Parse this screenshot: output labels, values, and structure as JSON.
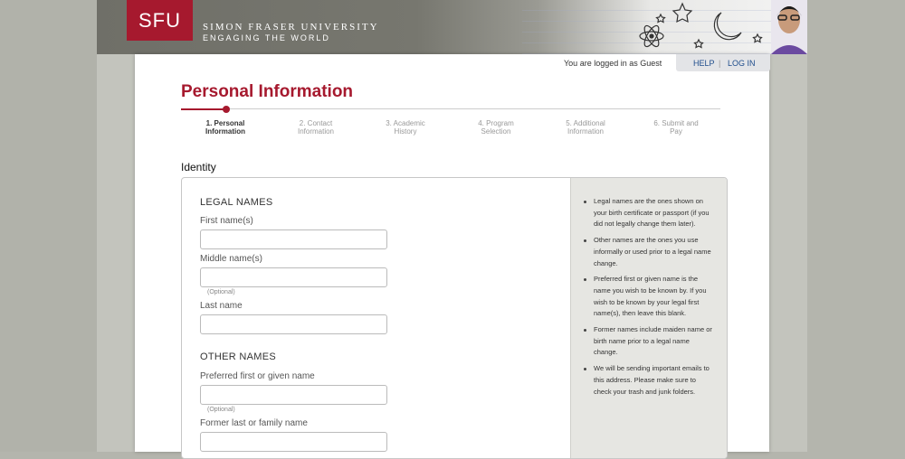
{
  "header": {
    "logo_text": "SFU",
    "university_name": "SIMON FRASER UNIVERSITY",
    "tagline": "ENGAGING THE WORLD"
  },
  "topbar": {
    "login_status": "You are logged in as Guest",
    "help_label": "HELP",
    "separator": "|",
    "login_label": "LOG IN"
  },
  "page_title": "Personal Information",
  "steps": [
    {
      "line1": "1. Personal",
      "line2": "Information",
      "active": true
    },
    {
      "line1": "2. Contact",
      "line2": "Information",
      "active": false
    },
    {
      "line1": "3. Academic",
      "line2": "History",
      "active": false
    },
    {
      "line1": "4. Program",
      "line2": "Selection",
      "active": false
    },
    {
      "line1": "5. Additional",
      "line2": "Information",
      "active": false
    },
    {
      "line1": "6. Submit and",
      "line2": "Pay",
      "active": false
    }
  ],
  "section_title": "Identity",
  "legal_names": {
    "title": "LEGAL NAMES",
    "first_label": "First name(s)",
    "middle_label": "Middle name(s)",
    "middle_hint": "(Optional)",
    "last_label": "Last name"
  },
  "other_names": {
    "title": "OTHER NAMES",
    "preferred_label": "Preferred first or given name",
    "preferred_hint": "(Optional)",
    "former_label": "Former last or family name"
  },
  "help_notes": [
    "Legal names are the ones shown on your birth certificate or passport (if you did not legally change them later).",
    "Other names are the ones you use informally or used prior to a legal name change.",
    "Preferred first or given name is the name you wish to be known by. If you wish to be known by your legal first name(s), then leave this blank.",
    "Former names include maiden name or birth name prior to a legal name change.",
    "We will be sending important emails to this address. Please make sure to check your trash and junk folders."
  ],
  "colors": {
    "brand_red": "#a6192e",
    "link_blue": "#1f4d8c"
  }
}
